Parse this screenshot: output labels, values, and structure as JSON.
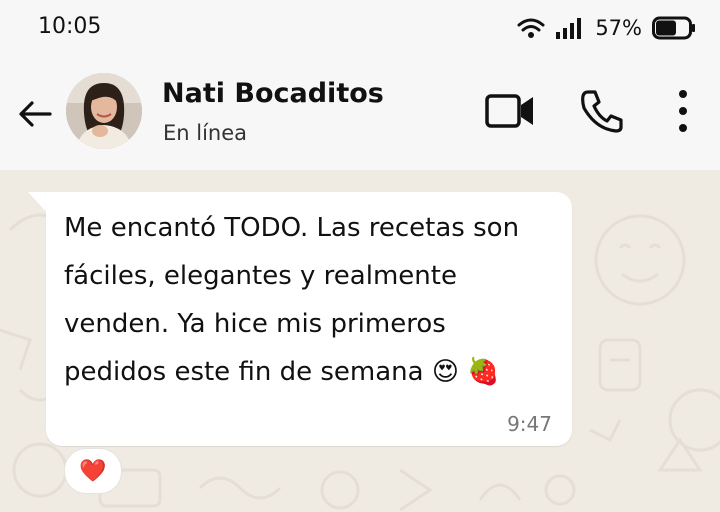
{
  "status_bar": {
    "time": "10:05",
    "battery": "57%",
    "wifi_icon": "wifi-icon",
    "signal_icon": "signal-icon",
    "battery_icon": "battery-icon"
  },
  "header": {
    "contact_name": "Nati Bocaditos",
    "contact_status": "En línea",
    "back_icon": "back-arrow-icon",
    "video_icon": "video-call-icon",
    "phone_icon": "phone-call-icon",
    "menu_icon": "more-vert-icon"
  },
  "message": {
    "lines": [
      "Me encantó TODO. Las recetas son",
      "fáciles, elegantes y realmente",
      "venden. Ya hice mis primeros",
      "pedidos este fin de semana"
    ],
    "emojis": [
      "😍",
      "🍓"
    ],
    "time": "9:47",
    "reaction": "❤️"
  },
  "colors": {
    "header_bg": "#f7f7f7",
    "chat_bg": "#efeae2",
    "bubble_bg": "#ffffff"
  }
}
